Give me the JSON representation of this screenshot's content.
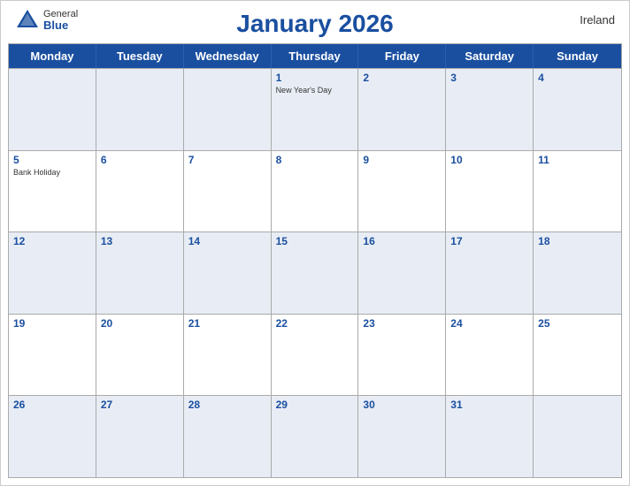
{
  "calendar": {
    "title": "January 2026",
    "country": "Ireland",
    "logo": {
      "general": "General",
      "blue": "Blue"
    },
    "day_headers": [
      "Monday",
      "Tuesday",
      "Wednesday",
      "Thursday",
      "Friday",
      "Saturday",
      "Sunday"
    ],
    "weeks": [
      [
        {
          "date": "",
          "month": "other"
        },
        {
          "date": "",
          "month": "other"
        },
        {
          "date": "",
          "month": "other"
        },
        {
          "date": "1",
          "month": "current",
          "holiday": "New Year's Day"
        },
        {
          "date": "2",
          "month": "current"
        },
        {
          "date": "3",
          "month": "current"
        },
        {
          "date": "4",
          "month": "current"
        }
      ],
      [
        {
          "date": "5",
          "month": "current",
          "holiday": "Bank Holiday"
        },
        {
          "date": "6",
          "month": "current"
        },
        {
          "date": "7",
          "month": "current"
        },
        {
          "date": "8",
          "month": "current"
        },
        {
          "date": "9",
          "month": "current"
        },
        {
          "date": "10",
          "month": "current"
        },
        {
          "date": "11",
          "month": "current"
        }
      ],
      [
        {
          "date": "12",
          "month": "current"
        },
        {
          "date": "13",
          "month": "current"
        },
        {
          "date": "14",
          "month": "current"
        },
        {
          "date": "15",
          "month": "current"
        },
        {
          "date": "16",
          "month": "current"
        },
        {
          "date": "17",
          "month": "current"
        },
        {
          "date": "18",
          "month": "current"
        }
      ],
      [
        {
          "date": "19",
          "month": "current"
        },
        {
          "date": "20",
          "month": "current"
        },
        {
          "date": "21",
          "month": "current"
        },
        {
          "date": "22",
          "month": "current"
        },
        {
          "date": "23",
          "month": "current"
        },
        {
          "date": "24",
          "month": "current"
        },
        {
          "date": "25",
          "month": "current"
        }
      ],
      [
        {
          "date": "26",
          "month": "current"
        },
        {
          "date": "27",
          "month": "current"
        },
        {
          "date": "28",
          "month": "current"
        },
        {
          "date": "29",
          "month": "current"
        },
        {
          "date": "30",
          "month": "current"
        },
        {
          "date": "31",
          "month": "current"
        },
        {
          "date": "",
          "month": "other"
        }
      ]
    ]
  }
}
